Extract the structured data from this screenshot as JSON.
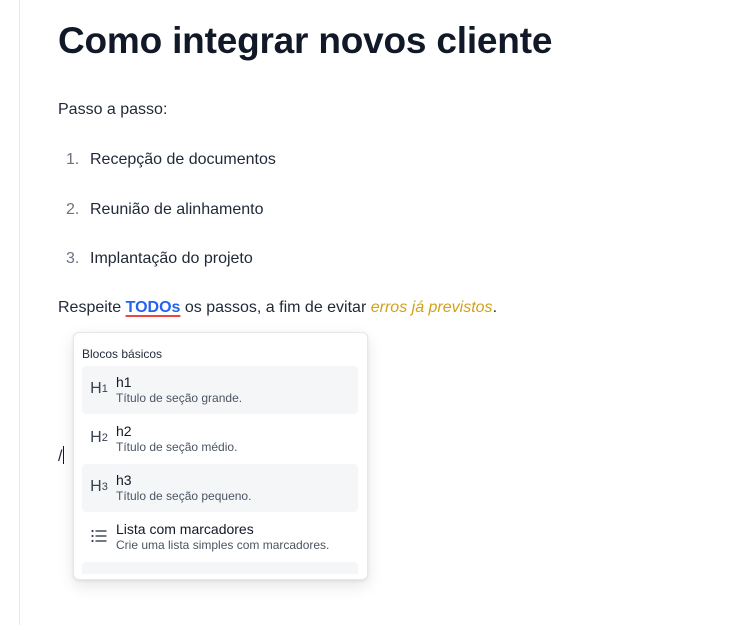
{
  "document": {
    "title": "Como integrar novos cliente",
    "intro": "Passo a passo:",
    "steps": [
      {
        "num": "1.",
        "text": "Recepção de documentos"
      },
      {
        "num": "2.",
        "text": "Reunião de alinhamento"
      },
      {
        "num": "3.",
        "text": "Implantação do projeto"
      }
    ],
    "respeite": {
      "before": "Respeite ",
      "link": "TODOs",
      "middle": " os passos, a fim de evitar ",
      "italic": "erros já previstos",
      "after": "."
    },
    "slash_input": "/"
  },
  "slash_menu": {
    "section_label": "Blocos básicos",
    "items": [
      {
        "icon": "heading-1-icon",
        "icon_letter": "H",
        "icon_sub": "1",
        "title": "h1",
        "desc": "Título de seção grande."
      },
      {
        "icon": "heading-2-icon",
        "icon_letter": "H",
        "icon_sub": "2",
        "title": "h2",
        "desc": "Título de seção médio."
      },
      {
        "icon": "heading-3-icon",
        "icon_letter": "H",
        "icon_sub": "3",
        "title": "h3",
        "desc": "Título de seção pequeno."
      },
      {
        "icon": "bullet-list-icon",
        "title": "Lista com marcadores",
        "desc": "Crie uma lista simples com marcadores."
      }
    ]
  },
  "colors": {
    "link": "#2563eb",
    "link_underline": "#ef4444",
    "italic_warning": "#d4a017"
  }
}
